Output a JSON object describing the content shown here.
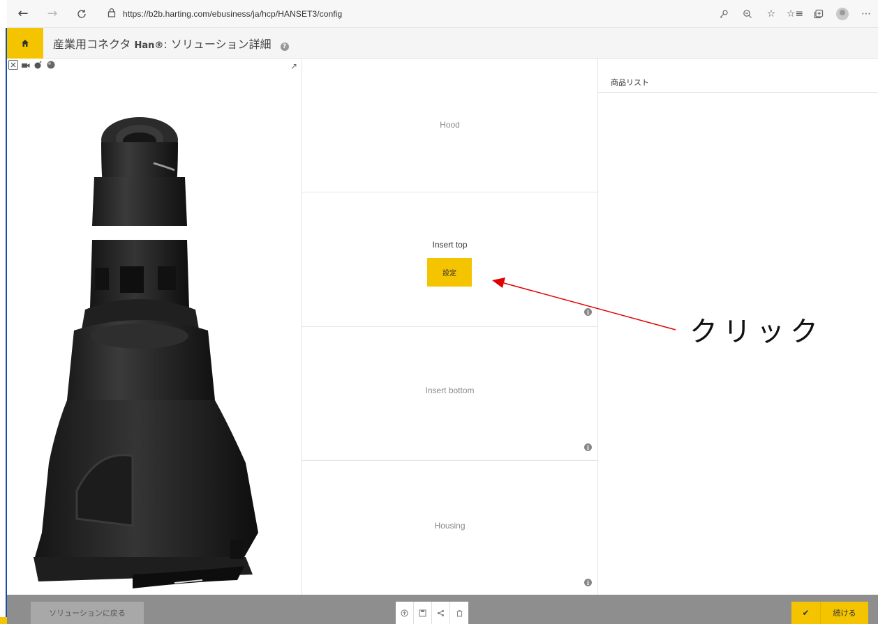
{
  "browser": {
    "url": "https://b2b.harting.com/ebusiness/ja/hcp/HANSET3/config"
  },
  "header": {
    "title_prefix": "産業用コネクタ",
    "title_brand": "Han®",
    "title_suffix": ": ソリューション詳細",
    "help_glyph": "?"
  },
  "config": {
    "slots": [
      {
        "label": "Hood"
      },
      {
        "label": "Insert top",
        "button": "設定"
      },
      {
        "label": "Insert bottom"
      },
      {
        "label": "Housing"
      }
    ],
    "info_glyph": "i"
  },
  "products": {
    "title": "商品リスト"
  },
  "annotation": {
    "text": "クリック",
    "color": "#e00000"
  },
  "footer": {
    "back_label": "ソリューションに戻る",
    "continue_label": "続ける"
  },
  "colors": {
    "accent": "#f5c400",
    "footer": "#8e8e8e"
  }
}
